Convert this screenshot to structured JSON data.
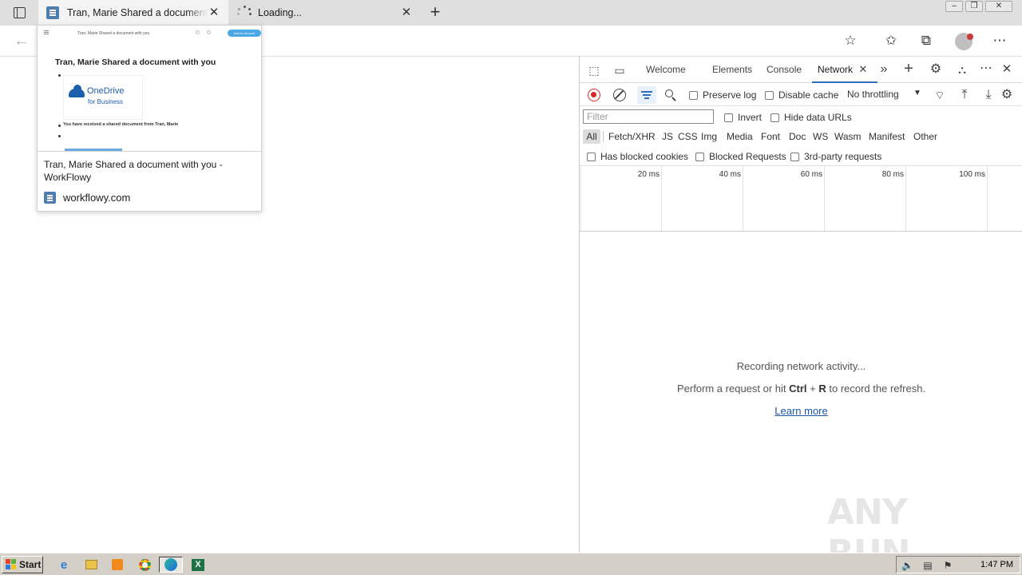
{
  "browser": {
    "tabs": [
      {
        "title": "Tran, Marie Shared a document with you - WorkFlowy",
        "active": true
      },
      {
        "title": "Loading...",
        "active": false
      }
    ]
  },
  "hover_card": {
    "preview": {
      "header_title": "Tran, Marie Shared a document with you",
      "header_button": "Add to account",
      "heading": "Tran, Marie Shared a document with you",
      "logo_line1": "OneDrive",
      "logo_line2": "for Business",
      "body_text": "You have received a shared document from Tran, Marie"
    },
    "title": "Tran, Marie Shared a document with you - WorkFlowy",
    "domain": "workflowy.com"
  },
  "devtools": {
    "tabs": [
      "Welcome",
      "Elements",
      "Console",
      "Network"
    ],
    "active_tab": "Network",
    "preserve_log": "Preserve log",
    "disable_cache": "Disable cache",
    "throttling": "No throttling",
    "filter_placeholder": "Filter",
    "invert": "Invert",
    "hide_data_urls": "Hide data URLs",
    "types": [
      "All",
      "Fetch/XHR",
      "JS",
      "CSS",
      "Img",
      "Media",
      "Font",
      "Doc",
      "WS",
      "Wasm",
      "Manifest",
      "Other"
    ],
    "has_blocked_cookies": "Has blocked cookies",
    "blocked_requests": "Blocked Requests",
    "third_party": "3rd-party requests",
    "timeline_ticks": [
      "20 ms",
      "40 ms",
      "60 ms",
      "80 ms",
      "100 ms"
    ],
    "empty_line1": "Recording network activity...",
    "empty_line2_pre": "Perform a request or hit ",
    "empty_shortcut_ctrl": "Ctrl",
    "empty_shortcut_plus": " + ",
    "empty_shortcut_r": "R",
    "empty_line2_post": " to record the refresh.",
    "learn_more": "Learn more"
  },
  "watermark": {
    "text": "ANY RUN"
  },
  "taskbar": {
    "start": "Start",
    "clock": "1:47 PM"
  },
  "colors": {
    "accent": "#2f6fbf",
    "record": "#d62a2a",
    "link": "#1a56a6"
  }
}
